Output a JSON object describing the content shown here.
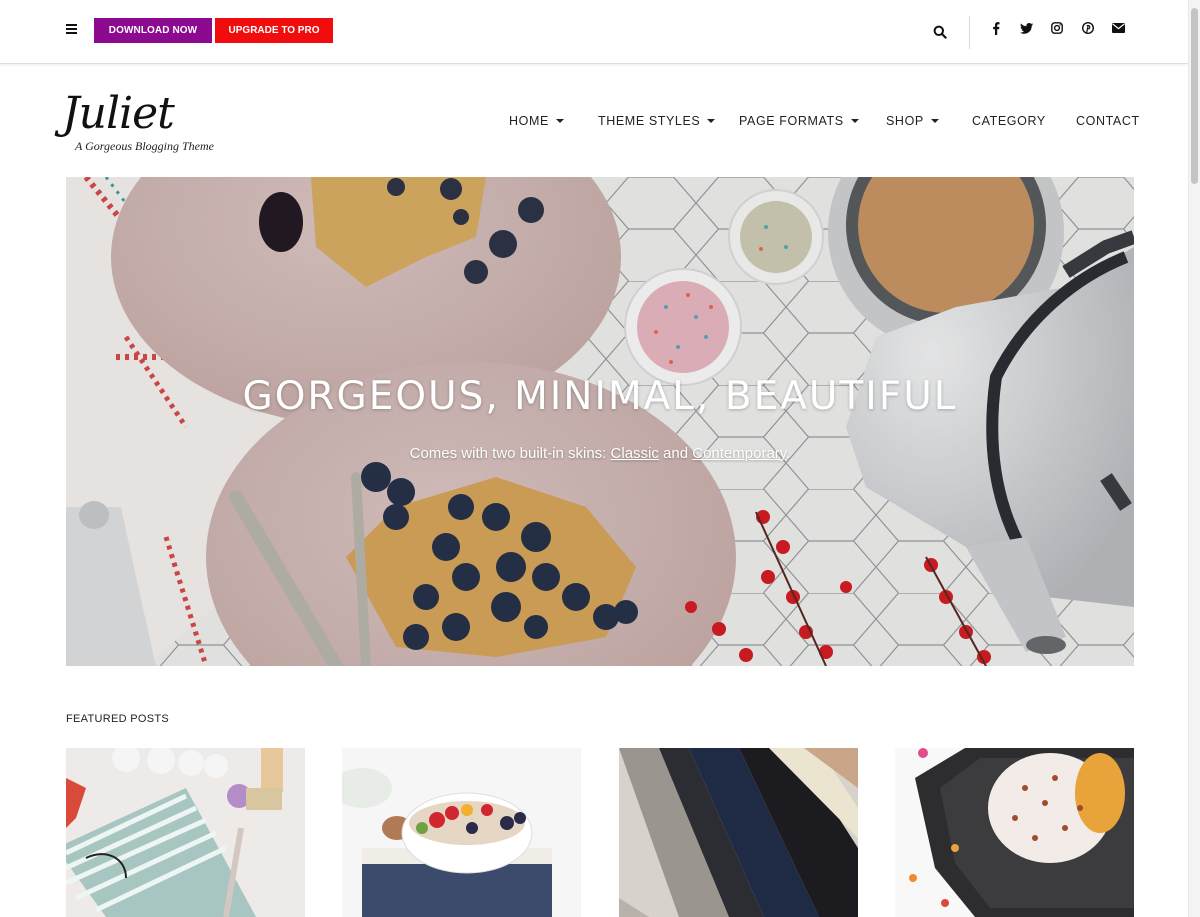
{
  "topbar": {
    "download_label": "DOWNLOAD NOW",
    "upgrade_label": "UPGRADE TO PRO",
    "social_icons": [
      "facebook-icon",
      "twitter-icon",
      "instagram-icon",
      "pinterest-icon",
      "envelope-icon"
    ]
  },
  "header": {
    "logo": "Juliet",
    "tagline": "A Gorgeous Blogging Theme"
  },
  "nav": {
    "home": "HOME",
    "theme_styles": "THEME STYLES",
    "page_formats": "PAGE FORMATS",
    "shop": "SHOP",
    "category": "CATEGORY",
    "contact": "CONTACT"
  },
  "hero": {
    "title": "GORGEOUS, MINIMAL, BEAUTIFUL",
    "subtitle_prefix": "Comes with two built-in skins: ",
    "link_classic": "Classic",
    "subtitle_and": " and ",
    "link_contemporary": "Contemporary",
    "subtitle_suffix": "."
  },
  "featured": {
    "label": "FEATURED POSTS"
  },
  "colors": {
    "download_bg": "#8b0a8f",
    "upgrade_bg": "#f10d0d"
  }
}
